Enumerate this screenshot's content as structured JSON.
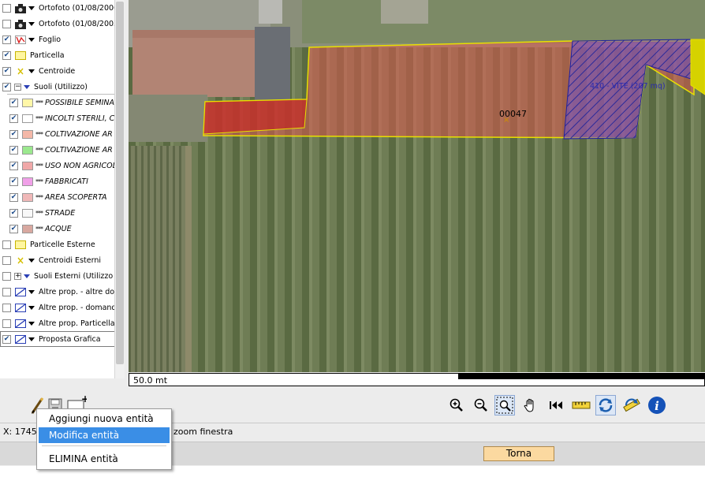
{
  "layers": [
    {
      "label": "Ortofoto (01/08/2006",
      "checked": false,
      "symbol": "camera"
    },
    {
      "label": "Ortofoto (01/08/2003",
      "checked": false,
      "symbol": "camera"
    },
    {
      "label": "Foglio",
      "checked": true,
      "symbol": "red-mark"
    },
    {
      "label": "Particella",
      "checked": true,
      "symbol": "yellow-box"
    },
    {
      "label": "Centroide",
      "checked": true,
      "symbol": "yellow-x"
    },
    {
      "label": "Suoli (Utilizzo)",
      "checked": true,
      "symbol": "minus"
    },
    {
      "label": "POSSIBILE SEMINA",
      "checked": true,
      "color": "#fff7a8",
      "sub": true
    },
    {
      "label": "INCOLTI STERILI, C",
      "checked": true,
      "color": "#ffffff",
      "sub": true
    },
    {
      "label": "COLTIVAZIONE AR",
      "checked": true,
      "color": "#f4b8a8",
      "sub": true
    },
    {
      "label": "COLTIVAZIONE AR",
      "checked": true,
      "color": "#9be88e",
      "sub": true
    },
    {
      "label": "USO NON AGRICOL",
      "checked": true,
      "color": "#f0a8a8",
      "sub": true
    },
    {
      "label": "FABBRICATI",
      "checked": true,
      "color": "#f0a0e8",
      "sub": true
    },
    {
      "label": "AREA SCOPERTA",
      "checked": true,
      "color": "#f0b8b8",
      "sub": true
    },
    {
      "label": "STRADE",
      "checked": true,
      "color": "#f8f8f8",
      "sub": true
    },
    {
      "label": "ACQUE",
      "checked": true,
      "color": "#d8a8a0",
      "sub": true
    },
    {
      "label": "Particelle Esterne",
      "checked": false,
      "symbol": "yellow-box"
    },
    {
      "label": "Centroidi Esterni",
      "checked": false,
      "symbol": "yellow-x"
    },
    {
      "label": "Suoli Esterni (Utilizzo",
      "checked": false,
      "symbol": "plus"
    },
    {
      "label": "Altre prop. - altre dor",
      "checked": false,
      "symbol": "hatch"
    },
    {
      "label": "Altre prop. - domand",
      "checked": false,
      "symbol": "hatch"
    },
    {
      "label": "Altre prop. Particella",
      "checked": false,
      "symbol": "hatch"
    },
    {
      "label": "Proposta Grafica",
      "checked": true,
      "symbol": "hatch"
    }
  ],
  "stars": "***",
  "map": {
    "parcel_label": "00047",
    "vite_label": "410 - VITE (207 mq)",
    "scale": "50.0 mt"
  },
  "edit_tools": [
    {
      "name": "pencil-icon"
    },
    {
      "name": "save-icon"
    },
    {
      "name": "add-menu-icon"
    }
  ],
  "map_tools": [
    {
      "name": "zoom-in-icon"
    },
    {
      "name": "zoom-out-icon"
    },
    {
      "name": "zoom-window-icon"
    },
    {
      "name": "pan-hand-icon"
    },
    {
      "name": "previous-extent-icon"
    },
    {
      "name": "measure-ruler-icon"
    },
    {
      "name": "refresh-icon"
    },
    {
      "name": "refresh-alt-icon"
    },
    {
      "name": "info-icon"
    }
  ],
  "status": {
    "coords": "X: 1745",
    "hint": "zoom finestra"
  },
  "torna": "Torna",
  "context_menu": {
    "items": [
      "Aggiungi nuova entità",
      "Modifica entità",
      "ELIMINA entità"
    ],
    "highlighted": 1
  },
  "colors": {
    "accent": "#3a8ee6",
    "torna_bg": "#fbd9a0",
    "parcel_outline": "#e8e000",
    "vite_fill": "#6a4cc8"
  }
}
